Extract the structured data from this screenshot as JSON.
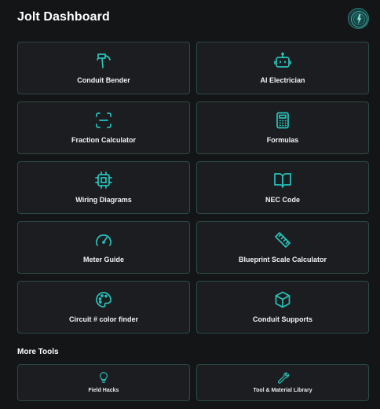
{
  "app": {
    "title": "Jolt Dashboard"
  },
  "colors": {
    "background": "#141517",
    "tile": "#1b1d20",
    "tile_border": "#2b4a47",
    "accent": "#27c4bb"
  },
  "tools": [
    {
      "label": "Conduit Bender",
      "icon": "hammer-icon"
    },
    {
      "label": "AI Electrician",
      "icon": "robot-icon"
    },
    {
      "label": "Fraction Calculator",
      "icon": "scan-icon"
    },
    {
      "label": "Formulas",
      "icon": "calculator-icon"
    },
    {
      "label": "Wiring Diagrams",
      "icon": "chip-icon"
    },
    {
      "label": "NEC Code",
      "icon": "book-icon"
    },
    {
      "label": "Meter Guide",
      "icon": "gauge-icon"
    },
    {
      "label": "Blueprint Scale Calculator",
      "icon": "ruler-icon"
    },
    {
      "label": "Circuit # color finder",
      "icon": "palette-icon"
    },
    {
      "label": "Conduit Supports",
      "icon": "box-icon"
    }
  ],
  "more_tools": {
    "title": "More Tools",
    "items": [
      {
        "label": "Field Hacks",
        "icon": "lightbulb-icon"
      },
      {
        "label": "Tool & Material Library",
        "icon": "wrench-icon"
      }
    ]
  }
}
